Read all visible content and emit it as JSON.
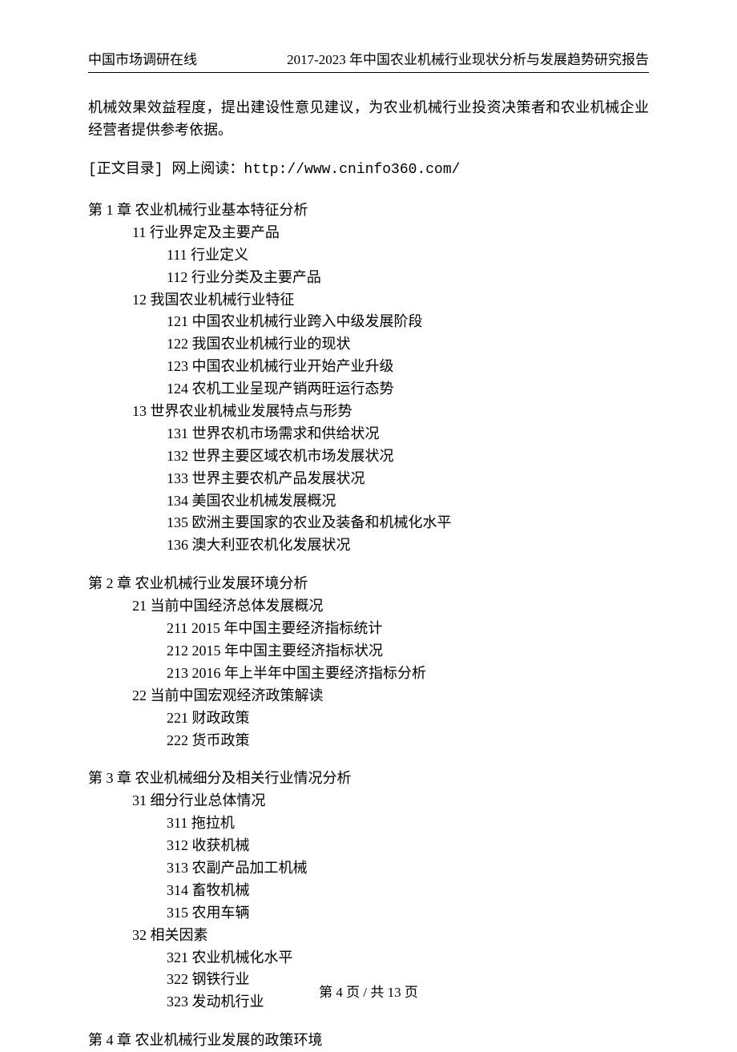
{
  "header": {
    "left": "中国市场调研在线",
    "right": "2017-2023 年中国农业机械行业现状分析与发展趋势研究报告"
  },
  "intro": "机械效果效益程度，提出建设性意见建议，为农业机械行业投资决策者和农业机械企业经营者提供参考依据。",
  "dir_link": "[正文目录] 网上阅读：http://www.cninfo360.com/",
  "chapters": [
    {
      "title": "第 1 章   农业机械行业基本特征分析",
      "sections": [
        {
          "title": "11 行业界定及主要产品",
          "items": [
            "111 行业定义",
            "112 行业分类及主要产品"
          ]
        },
        {
          "title": "12 我国农业机械行业特征",
          "items": [
            "121 中国农业机械行业跨入中级发展阶段",
            "122 我国农业机械行业的现状",
            "123 中国农业机械行业开始产业升级",
            "124 农机工业呈现产销两旺运行态势"
          ]
        },
        {
          "title": "13 世界农业机械业发展特点与形势",
          "items": [
            "131 世界农机市场需求和供给状况",
            "132 世界主要区域农机市场发展状况",
            "133 世界主要农机产品发展状况",
            "134 美国农业机械发展概况",
            "135 欧洲主要国家的农业及装备和机械化水平",
            "136 澳大利亚农机化发展状况"
          ]
        }
      ]
    },
    {
      "title": "第 2 章   农业机械行业发展环境分析",
      "sections": [
        {
          "title": "21 当前中国经济总体发展概况",
          "items": [
            "211 2015 年中国主要经济指标统计",
            "212 2015 年中国主要经济指标状况",
            "213 2016 年上半年中国主要经济指标分析"
          ]
        },
        {
          "title": "22 当前中国宏观经济政策解读",
          "items": [
            "221 财政政策",
            "222 货币政策"
          ]
        }
      ]
    },
    {
      "title": "第 3 章   农业机械细分及相关行业情况分析",
      "sections": [
        {
          "title": "31 细分行业总体情况",
          "items": [
            "311 拖拉机",
            "312 收获机械",
            "313 农副产品加工机械",
            "314 畜牧机械",
            "315 农用车辆"
          ]
        },
        {
          "title": "32 相关因素",
          "items": [
            "321 农业机械化水平",
            "322 钢铁行业",
            "323 发动机行业"
          ]
        }
      ]
    },
    {
      "title": "第 4 章   农业机械行业发展的政策环境",
      "sections": []
    }
  ],
  "footer": "第 4 页 / 共 13 页"
}
